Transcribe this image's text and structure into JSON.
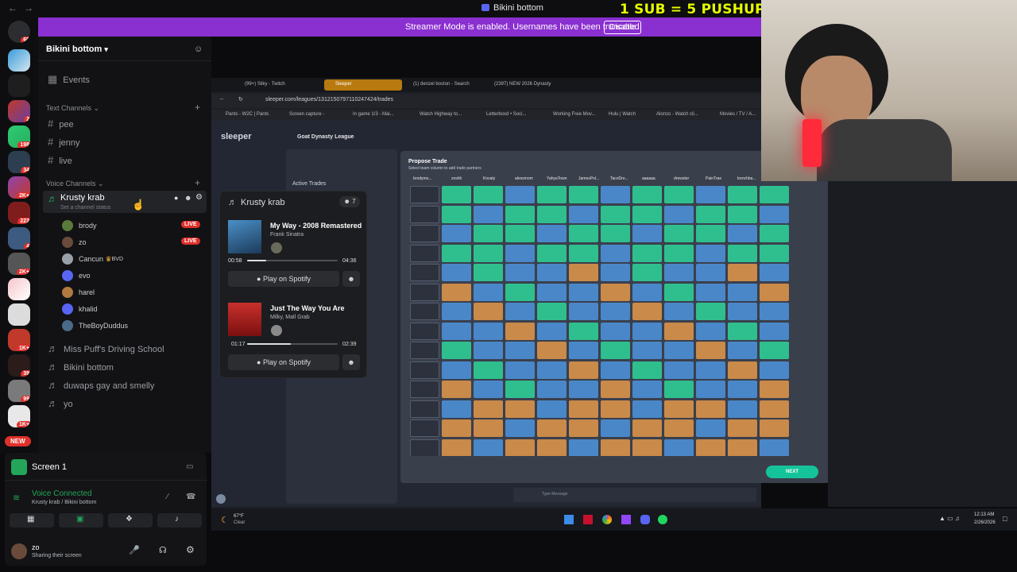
{
  "window": {
    "title": "Bikini bottom",
    "back_label": "←",
    "forward_label": "→"
  },
  "overlay": {
    "text": "1 SUB = 5 PUSHUPS"
  },
  "banner": {
    "message": "Streamer Mode is enabled. Usernames have been truncated.",
    "button": "Disable"
  },
  "servers": {
    "badges": [
      "69",
      "2",
      "198",
      "34",
      "2K+",
      "223",
      "4",
      "2K+",
      "1K+",
      "39",
      "99",
      "1K+"
    ],
    "new_label": "NEW"
  },
  "channel_panel": {
    "guild_name": "Bikini bottom",
    "events": "Events",
    "text_category": "Text Channels",
    "text_channels": [
      "pee",
      "jenny",
      "live"
    ],
    "voice_category": "Voice Channels",
    "active_voice": {
      "name": "Krusty krab",
      "status": "Set a channel status"
    },
    "members": [
      {
        "name": "brody",
        "live": "LIVE",
        "color": "#5a7a3a"
      },
      {
        "name": "zo",
        "live": "LIVE",
        "color": "#6a4a3a"
      },
      {
        "name": "Cancun",
        "tag": "BVD",
        "color": "#9aa0a8"
      },
      {
        "name": "evo",
        "color": "#5865f2"
      },
      {
        "name": "harel",
        "color": "#b07a40"
      },
      {
        "name": "khalid",
        "color": "#5865f2"
      },
      {
        "name": "TheBoyDuddus",
        "color": "#4a6a8a"
      }
    ],
    "other_voice": [
      "Miss Puff's Driving School",
      "Bikini bottom",
      "duwaps gay and smelly",
      "yo"
    ]
  },
  "voice_card": {
    "channel": "Krusty krab",
    "count": "7",
    "tracks": [
      {
        "title": "My Way - 2008 Remastered",
        "artist": "Frank Sinatra",
        "elapsed": "00:58",
        "duration": "04:36",
        "progress": 0.21,
        "button": "Play on Spotify"
      },
      {
        "title": "Just The Way You Are",
        "artist": "Milky, Mall Grab",
        "elapsed": "01:17",
        "duration": "02:39",
        "progress": 0.48,
        "button": "Play on Spotify"
      }
    ]
  },
  "screen_panel": {
    "title": "Screen 1",
    "voice_status": "Voice Connected",
    "voice_location": "Krusty krab / Bikini bottom",
    "user": "zo",
    "user_status": "Sharing their screen"
  },
  "browser": {
    "tabs": [
      "(99+) Silky - Twitch",
      "Sleeper",
      "(1) denzel boston - Search",
      "(2397) NEW 2026 Dynasty"
    ],
    "url": "sleeper.com/leagues/1312150797110247424/trades",
    "bookmarks": [
      "Pants - W2C | Pants",
      "Screen capture -",
      "In game 1/3 - Mai...",
      "Watch Highway to...",
      "Letterboxd • Soci...",
      "Working Free Mov...",
      "Hulu | Watch",
      "Alonzo - Watch cli...",
      "Movies / TV / A..."
    ],
    "app_logo": "sleeper",
    "league": "Goat Dynasty League",
    "side_title": "Active Trades",
    "modal_title": "Propose Trade",
    "modal_subtitle": "Select team column to add trade partners",
    "next_button": "NEXT",
    "team_headers": [
      "brodymo...",
      "zoshh",
      "Kovaty",
      "alexsmom",
      "YahyaTown",
      "JamesPol...",
      "TacoDre...",
      "aaaaaa",
      "drewster",
      "PainTrae",
      "trenchba...",
      "..."
    ],
    "chat_placeholder": "Type Message"
  },
  "taskbar": {
    "weather_temp": "67°F",
    "weather_text": "Clear",
    "time": "12:13 AM",
    "date": "2/26/2026"
  }
}
